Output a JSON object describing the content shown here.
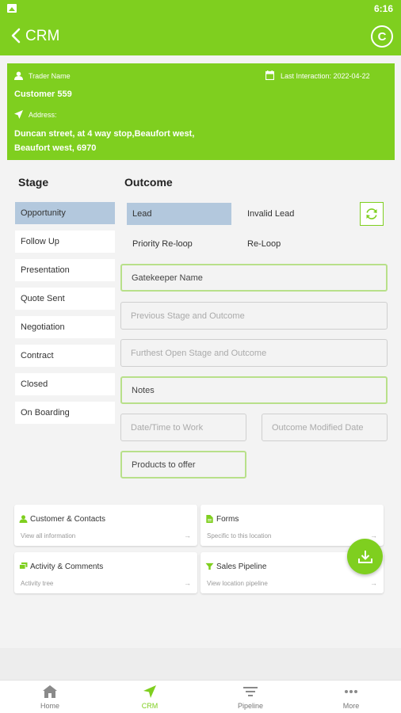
{
  "status_bar": {
    "time": "6:16"
  },
  "app_bar": {
    "title": "CRM",
    "profile_button": "C"
  },
  "customer": {
    "trader_name_label": "Trader Name",
    "name": "Customer 559",
    "last_interaction_label": "Last Interaction: 2022-04-22",
    "address_label": "Address:",
    "address_line1": "Duncan street, at 4 way stop,Beaufort west,",
    "address_line2": "Beaufort west, 6970"
  },
  "stage": {
    "heading": "Stage",
    "items": [
      "Opportunity",
      "Follow Up",
      "Presentation",
      "Quote Sent",
      "Negotiation",
      "Contract",
      "Closed",
      "On Boarding"
    ],
    "selected": "Opportunity"
  },
  "outcome": {
    "heading": "Outcome",
    "options": [
      "Lead",
      "Invalid Lead",
      "Priority Re-loop",
      "Re-Loop"
    ],
    "selected": "Lead"
  },
  "fields": {
    "gatekeeper": "Gatekeeper Name",
    "previous_stage": "Previous Stage and Outcome",
    "furthest_stage": "Furthest Open Stage and Outcome",
    "notes": "Notes",
    "date_time": "Date/Time to Work",
    "outcome_modified": "Outcome Modified Date",
    "products": "Products to offer"
  },
  "quick_links": [
    {
      "title": "Customer & Contacts",
      "subtitle": "View all information",
      "icon": "person-icon"
    },
    {
      "title": "Forms",
      "subtitle": "Specific to this location",
      "icon": "document-icon"
    },
    {
      "title": "Activity & Comments",
      "subtitle": "Activity tree",
      "icon": "comments-icon"
    },
    {
      "title": "Sales Pipeline",
      "subtitle": "View location pipeline",
      "icon": "funnel-icon"
    }
  ],
  "bottom_nav": {
    "items": [
      "Home",
      "CRM",
      "Pipeline",
      "More"
    ],
    "active": "CRM"
  },
  "colors": {
    "accent": "#7fcf1f",
    "selected": "#b3c8dd",
    "background": "#f3f3f3"
  }
}
